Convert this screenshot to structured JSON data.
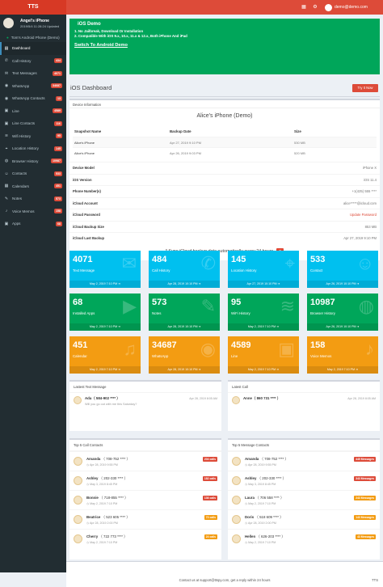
{
  "app": {
    "logo": "TTS",
    "email": "demo@demo.com"
  },
  "profile": {
    "name": "Angel's iPhone",
    "updated": "2019/5/4 11:28:24 Updated"
  },
  "sidebar": {
    "device": "Tom's Android Phone (Demo)",
    "items": [
      {
        "label": "Dashboard",
        "icon": "dashboard-icon",
        "badge": ""
      },
      {
        "label": "Call History",
        "icon": "phone-icon",
        "badge": "434"
      },
      {
        "label": "Text Messages",
        "icon": "message-icon",
        "badge": "4071"
      },
      {
        "label": "WhatsApp",
        "icon": "whatsapp-icon",
        "badge": "34687"
      },
      {
        "label": "WhatsApp Contacts",
        "icon": "whatsapp-icon",
        "badge": "13"
      },
      {
        "label": "Line",
        "icon": "line-icon",
        "badge": "4589"
      },
      {
        "label": "Line Contacts",
        "icon": "line-icon",
        "badge": "116"
      },
      {
        "label": "Wifi History",
        "icon": "wifi-icon",
        "badge": "95"
      },
      {
        "label": "Location History",
        "icon": "location-icon",
        "badge": "145"
      },
      {
        "label": "Browser History",
        "icon": "globe-icon",
        "badge": "10987"
      },
      {
        "label": "Contacts",
        "icon": "contacts-icon",
        "badge": "533"
      },
      {
        "label": "Calendars",
        "icon": "calendar-icon",
        "badge": "451"
      },
      {
        "label": "Notes",
        "icon": "notes-icon",
        "badge": "573"
      },
      {
        "label": "Voice Memos",
        "icon": "mic-icon",
        "badge": "158"
      },
      {
        "label": "Apps",
        "icon": "apps-icon",
        "badge": "68"
      }
    ]
  },
  "callout": {
    "title": "iOS Demo",
    "line1": "1. No Jailbreak, Download Or Installation",
    "line2": "2. Compatible With iOS 9.x, 10.x, 11.x & 12.x, Both iPhone And iPad",
    "switch_label": "Switch To Android Demo"
  },
  "dashboard": {
    "title": "iOS Dashboard",
    "try_label": "Try It Now"
  },
  "device_info": {
    "header": "Device Information",
    "device_name": "Alice's iPhone (Demo)",
    "snapshot_headers": [
      "Snapshot Name",
      "Backup Date",
      "Size"
    ],
    "snapshots": [
      [
        "Alice's iPhone",
        "Apr 27, 2019 9:10 PM",
        "530 MB"
      ],
      [
        "Alice's iPhone",
        "Apr 26, 2019 9:03 PM",
        "520 MB"
      ]
    ],
    "specs": [
      {
        "k": "Device Model",
        "v": "iPhone X"
      },
      {
        "k": "iOS Version",
        "v": "iOS 11.4"
      },
      {
        "k": "Phone Number(s)",
        "v": "+1(425) 555 ****"
      },
      {
        "k": "iCloud Account",
        "v": "alice*****@icloud.com"
      },
      {
        "k": "iCloud Password",
        "v": "Update Password"
      },
      {
        "k": "iCloud Backup Size",
        "v": "853 MB"
      },
      {
        "k": "iCloud Last Backup",
        "v": "Apr 27, 2019 9:10 PM"
      }
    ],
    "sync_message": "* Sync iCloud backup data automatically every 24 hours"
  },
  "tiles": [
    {
      "num": "4071",
      "label": "Text Message",
      "foot": "May 2, 2019 7:10 PM",
      "icon": "chat-icon"
    },
    {
      "num": "484",
      "label": "Call History",
      "foot": "Apr 28, 2019 10:10 PM",
      "icon": "phone-icon"
    },
    {
      "num": "145",
      "label": "Location History",
      "foot": "Apr 27, 2019 10:10 PM",
      "icon": "location-icon"
    },
    {
      "num": "533",
      "label": "Contact",
      "foot": "Apr 26, 2019 10:10 PM",
      "icon": "add-user-icon"
    },
    {
      "num": "68",
      "label": "Installed Apps",
      "foot": "May 2, 2019 7:10 PM",
      "icon": "play-icon"
    },
    {
      "num": "573",
      "label": "Notes",
      "foot": "Apr 28, 2019 10:10 PM",
      "icon": "notes-icon"
    },
    {
      "num": "95",
      "label": "WiFi History",
      "foot": "May 2, 2019 7:10 PM",
      "icon": "wifi-icon"
    },
    {
      "num": "10987",
      "label": "Browser History",
      "foot": "Apr 26, 2019 10:10 PM",
      "icon": "globe-icon"
    },
    {
      "num": "451",
      "label": "Calendar",
      "foot": "May 2, 2019 7:10 PM",
      "icon": "bell-icon"
    },
    {
      "num": "34687",
      "label": "WhatsApp",
      "foot": "Apr 28, 2019 10:10 PM",
      "icon": "whatsapp-icon"
    },
    {
      "num": "4589",
      "label": "Line",
      "foot": "May 2, 2019 7:10 PM",
      "icon": "line-icon"
    },
    {
      "num": "158",
      "label": "Voice Memos",
      "foot": "May 2, 2019 7:10 PM",
      "icon": "mic-icon"
    }
  ],
  "latest_text": {
    "header": "Lastest Text Message",
    "name": "Ada（ 584-902 **** ）",
    "time": "Apr 28, 2019 8:05 AM",
    "message": "Will you go out with me this Saturday?"
  },
  "latest_call": {
    "header": "Latest Call",
    "name": "Anne（ 860 731 **** ）",
    "time": "Apr 28, 2019 8:05 AM"
  },
  "top_calls": {
    "header": "Top 5 Call Contacts",
    "items": [
      {
        "name": "Amanda",
        "phone": "（ 708-752 **** ）",
        "date": "Apr 28, 2019 9:55 PM",
        "badge": "204 calls"
      },
      {
        "name": "Ashley",
        "phone": "（ 202-330 **** ）",
        "date": "May 3, 2019 8:45 PM",
        "badge": "182 calls"
      },
      {
        "name": "Bonnie",
        "phone": "（ 718-855 **** ）",
        "date": "May 2, 2019 7:10 PM",
        "badge": "136 calls"
      },
      {
        "name": "Beatrice",
        "phone": "（ 523 605 **** ）",
        "date": "Apr 28, 2019 2:00 PM",
        "badge": "73 calls"
      },
      {
        "name": "Cherry",
        "phone": "（ 722 773 **** ）",
        "date": "May 2, 2019 7:10 PM",
        "badge": "24 calls"
      }
    ]
  },
  "top_messages": {
    "header": "Top 5 Message Contacts",
    "items": [
      {
        "name": "Amanda",
        "phone": "（ 708-752 **** ）",
        "date": "Apr 28, 2019 9:55 PM",
        "badge": "445 Messages"
      },
      {
        "name": "Ashley",
        "phone": "（ 202-330 **** ）",
        "date": "May 3, 2019 8:45 PM",
        "badge": "343 Messages"
      },
      {
        "name": "Laura",
        "phone": "（ 706 558 **** ）",
        "date": "May 2, 2019 7:10 PM",
        "badge": "243 Messages"
      },
      {
        "name": "Doris",
        "phone": "（ 518 609 **** ）",
        "date": "Apr 28, 2019 2:00 PM",
        "badge": "143 Messages"
      },
      {
        "name": "Hellen",
        "phone": "（ 626-203 **** ）",
        "date": "May 2, 2019 7:10 PM",
        "badge": "43 Messages"
      }
    ]
  },
  "footer": {
    "text": "Contact us at support@ttspy.com, get a reply within 24 hours",
    "brand": "TTS"
  },
  "colors": {
    "red": "#dd4b39",
    "green": "#00a65a",
    "blue": "#00c0ef",
    "orange": "#f39c12",
    "sidebar": "#222d32"
  }
}
